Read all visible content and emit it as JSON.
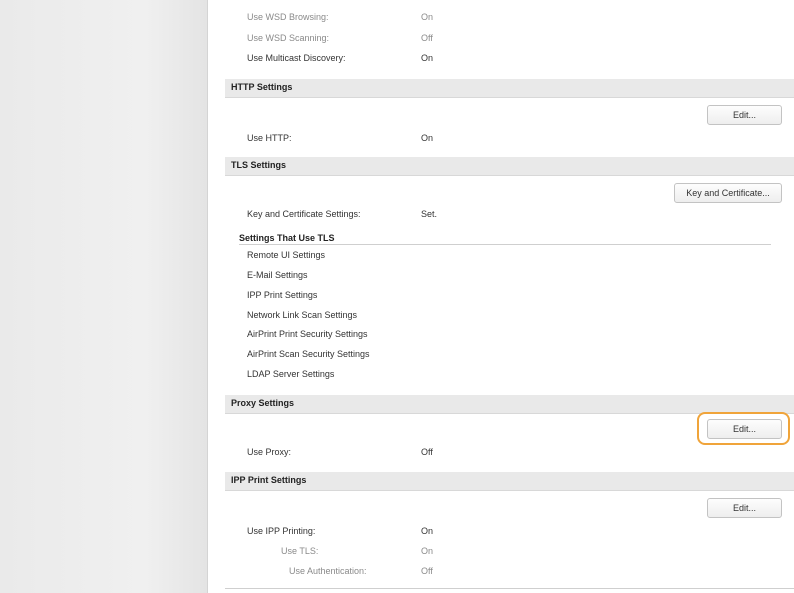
{
  "top_settings": [
    {
      "label": "Use WSD Browsing:",
      "value": "On"
    },
    {
      "label": "Use WSD Scanning:",
      "value": "Off"
    },
    {
      "label": "Use Multicast Discovery:",
      "value": "On"
    }
  ],
  "http": {
    "title": "HTTP Settings",
    "edit_label": "Edit...",
    "rows": [
      {
        "label": "Use HTTP:",
        "value": "On"
      }
    ]
  },
  "tls": {
    "title": "TLS Settings",
    "key_button_label": "Key and Certificate...",
    "key_setting": {
      "label": "Key and Certificate Settings:",
      "value": "Set."
    },
    "subsection_title": "Settings That Use TLS",
    "uses": [
      "Remote UI Settings",
      "E-Mail Settings",
      "IPP Print Settings",
      "Network Link Scan Settings",
      "AirPrint Print Security Settings",
      "AirPrint Scan Security Settings",
      "LDAP Server Settings"
    ]
  },
  "proxy": {
    "title": "Proxy Settings",
    "edit_label": "Edit...",
    "rows": [
      {
        "label": "Use Proxy:",
        "value": "Off"
      }
    ]
  },
  "ipp": {
    "title": "IPP Print Settings",
    "edit_label": "Edit...",
    "rows": [
      {
        "label": "Use IPP Printing:",
        "value": "On"
      },
      {
        "label": "Use TLS:",
        "value": "On"
      },
      {
        "label": "Use Authentication:",
        "value": "Off"
      }
    ]
  },
  "colors": {
    "section_bar": "#e9e9e9",
    "highlight": "#f0a43a",
    "sidebar": "#efefef"
  }
}
